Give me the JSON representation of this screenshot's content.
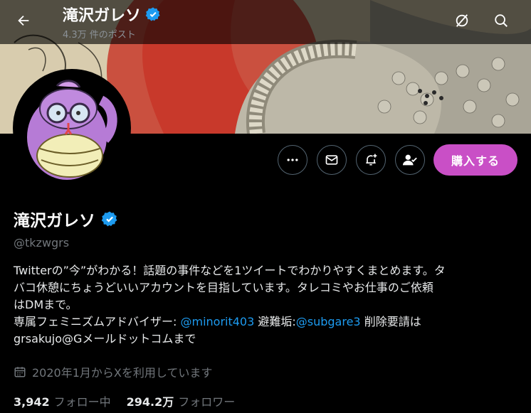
{
  "header": {
    "title": "滝沢ガレソ",
    "post_count": "4.3万 件のポスト"
  },
  "profile": {
    "display_name": "滝沢ガレソ",
    "handle": "@tkzwgrs",
    "bio_line1": "Twitterの”今”がわかる！話題の事件などを1ツイートでわかりやすくまとめます。タ",
    "bio_line2": "バコ休憩にちょうどいいアカウントを目指しています。タレコミやお仕事のご依頼",
    "bio_line3": "はDMまで。",
    "bio_line4_prefix": "専属フェミニズムアドバイザー: ",
    "bio_link1": "@minorit403",
    "bio_mid": " 避難垢:",
    "bio_link2": "@subgare3",
    "bio_line4_suffix": " 削除要請は",
    "bio_line5": "grsakujo@Gメールドットコムまで",
    "joined": "2020年1月からXを利用しています",
    "following_count": "3,942",
    "following_label": "フォロー中",
    "followers_count": "294.2万",
    "followers_label": "フォロワー"
  },
  "actions": {
    "buy_label": "購入する"
  },
  "colors": {
    "accent_buy": "#c94fc6",
    "link": "#1d9bf0",
    "verified": "#1d9bf0"
  },
  "icons": [
    "back-arrow-icon",
    "grok-icon",
    "search-icon",
    "more-icon",
    "mail-icon",
    "notify-add-icon",
    "follow-check-icon",
    "verified-badge-icon",
    "calendar-icon"
  ]
}
